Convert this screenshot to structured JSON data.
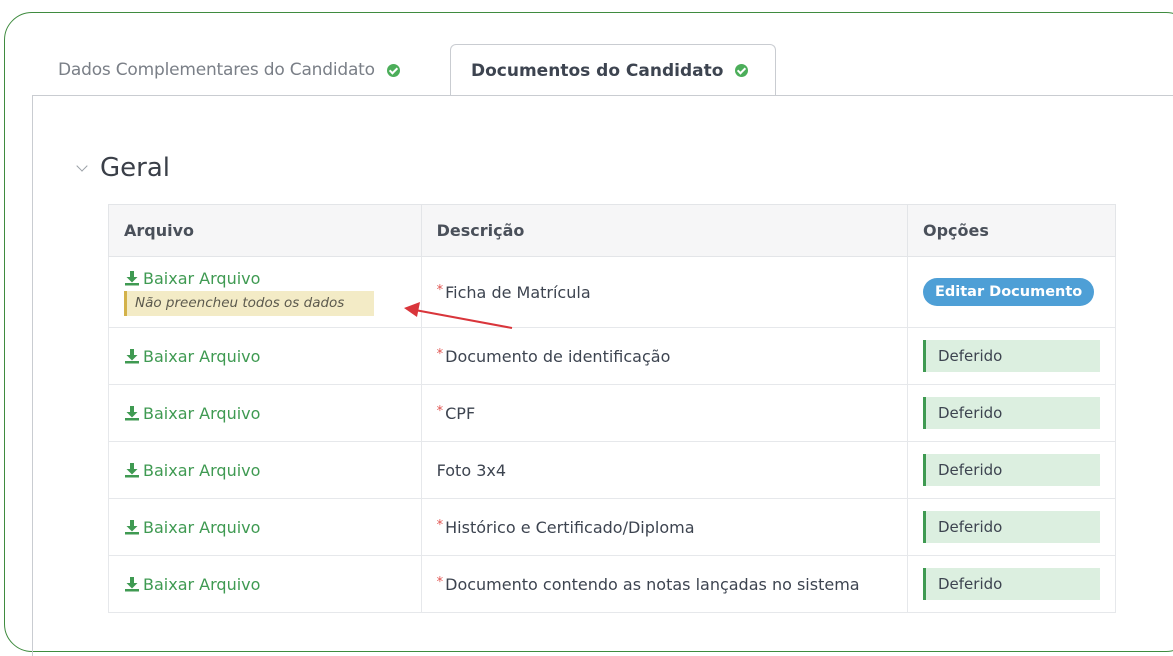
{
  "tabs": [
    {
      "label": "Dados Complementares do Candidato",
      "active": false,
      "complete": true
    },
    {
      "label": "Documentos do Candidato",
      "active": true,
      "complete": true
    }
  ],
  "section": {
    "title": "Geral"
  },
  "table": {
    "headers": [
      "Arquivo",
      "Descrição",
      "Opções"
    ],
    "download_label": "Baixar Arquivo",
    "rows": [
      {
        "description": "Ficha de Matrícula",
        "required": true,
        "warning": "Não preencheu todos os dados",
        "option": "Editar Documento",
        "option_type": "button"
      },
      {
        "description": "Documento de identificação",
        "required": true,
        "option": "Deferido",
        "option_type": "status"
      },
      {
        "description": "CPF",
        "required": true,
        "option": "Deferido",
        "option_type": "status"
      },
      {
        "description": "Foto 3x4",
        "required": false,
        "option": "Deferido",
        "option_type": "status"
      },
      {
        "description": "Histórico e Certificado/Diploma",
        "required": true,
        "option": "Deferido",
        "option_type": "status"
      },
      {
        "description": "Documento contendo as notas lançadas no sistema",
        "required": true,
        "option": "Deferido",
        "option_type": "status"
      }
    ]
  },
  "required_marker": "*",
  "colors": {
    "accent_green": "#3f9a52",
    "button_blue": "#4e9fd6",
    "status_bg": "#dcefe0",
    "warning_bg": "#f3ebc6",
    "annotation_arrow": "#d9353b"
  }
}
